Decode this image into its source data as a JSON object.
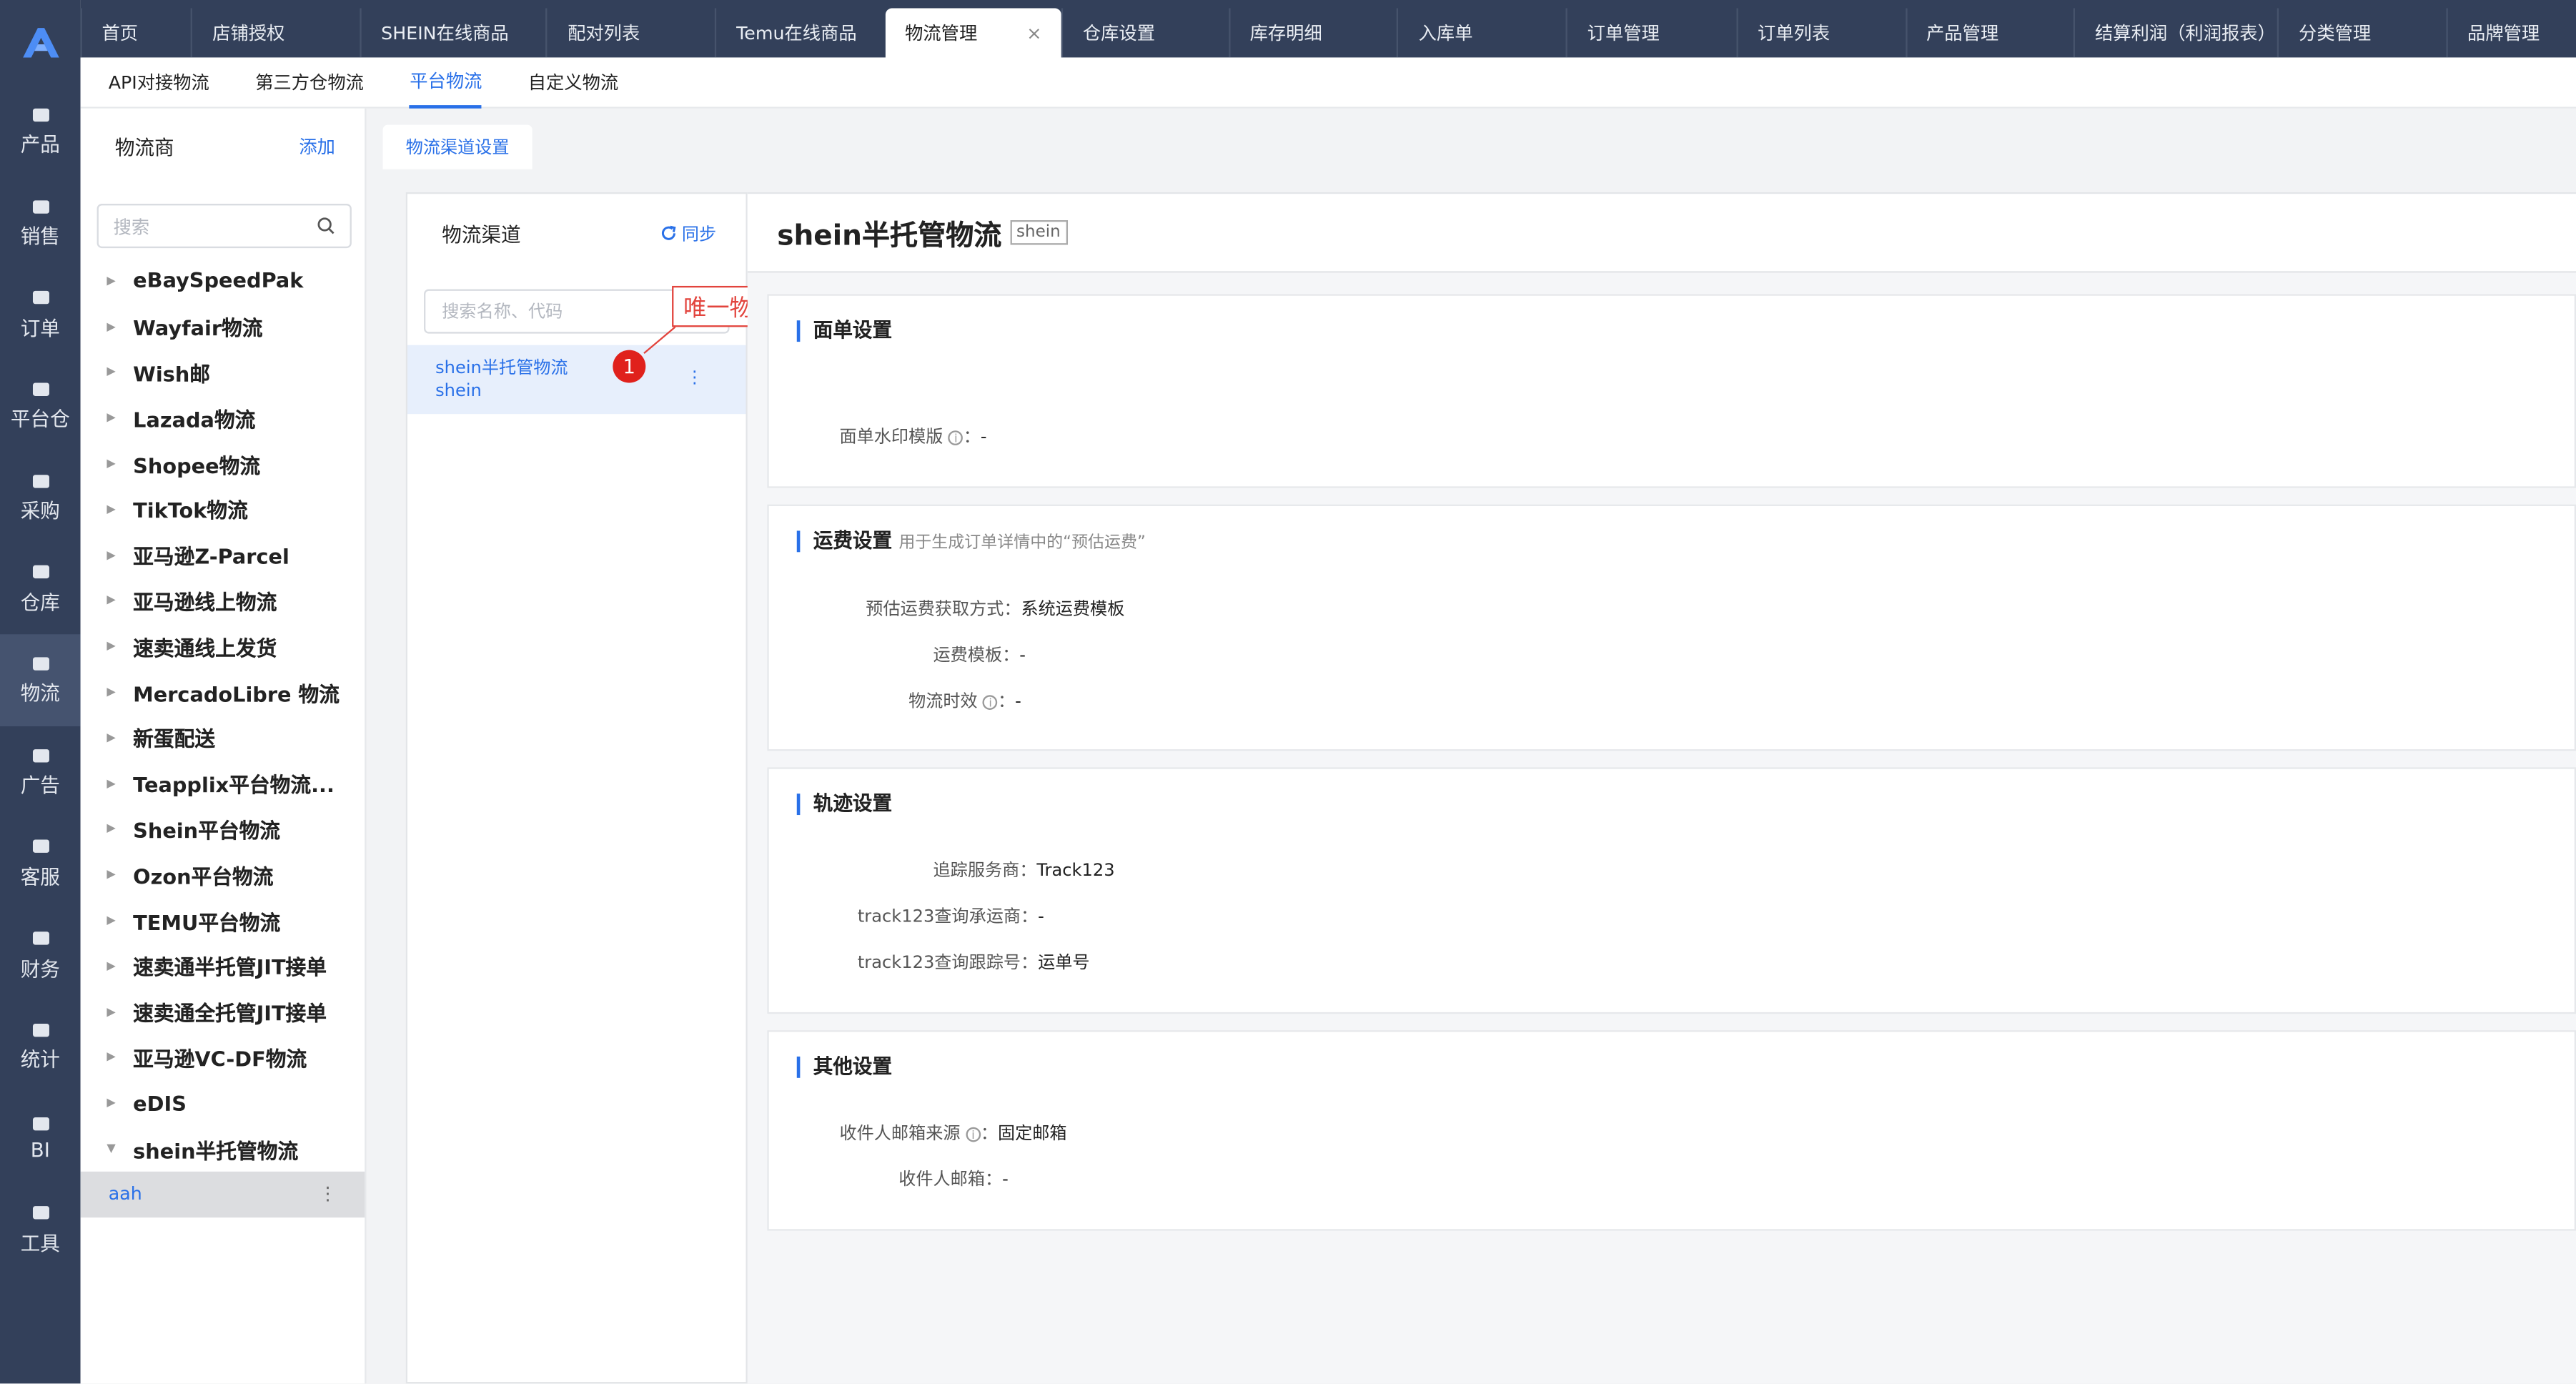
{
  "nav": {
    "items": [
      {
        "label": "产品",
        "icon": "box-icon"
      },
      {
        "label": "销售",
        "icon": "sell-icon"
      },
      {
        "label": "订单",
        "icon": "order-icon"
      },
      {
        "label": "平台仓",
        "icon": "warehouse-icon"
      },
      {
        "label": "采购",
        "icon": "cart-icon"
      },
      {
        "label": "仓库",
        "icon": "store-icon"
      },
      {
        "label": "物流",
        "icon": "truck-icon"
      },
      {
        "label": "广告",
        "icon": "ad-icon"
      },
      {
        "label": "客服",
        "icon": "mail-icon"
      },
      {
        "label": "财务",
        "icon": "yen-icon"
      },
      {
        "label": "统计",
        "icon": "pie-icon"
      },
      {
        "label": "BI",
        "icon": "bi-icon"
      },
      {
        "label": "工具",
        "icon": "wrench-icon"
      }
    ]
  },
  "tabs": [
    {
      "label": "首页"
    },
    {
      "label": "店铺授权"
    },
    {
      "label": "SHEIN在线商品"
    },
    {
      "label": "配对列表"
    },
    {
      "label": "Temu在线商品"
    },
    {
      "label": "物流管理",
      "close": "×"
    },
    {
      "label": "仓库设置"
    },
    {
      "label": "库存明细"
    },
    {
      "label": "入库单"
    },
    {
      "label": "订单管理"
    },
    {
      "label": "订单列表"
    },
    {
      "label": "产品管理"
    },
    {
      "label": "结算利润（利润报表）"
    },
    {
      "label": "分类管理"
    },
    {
      "label": "品牌管理"
    }
  ],
  "subtabs": [
    {
      "label": "API对接物流"
    },
    {
      "label": "第三方仓物流"
    },
    {
      "label": "平台物流"
    },
    {
      "label": "自定义物流"
    }
  ],
  "left": {
    "title": "物流商",
    "add": "添加",
    "search_placeholder": "搜索",
    "providers": [
      "eBaySpeedPak",
      "Wayfair物流",
      "Wish邮",
      "Lazada物流",
      "Shopee物流",
      "TikTok物流",
      "亚马逊Z-Parcel",
      "亚马逊线上物流",
      "速卖通线上发货",
      "MercadoLibre 物流",
      "新蛋配送",
      "Teapplix平台物流...",
      "Shein平台物流",
      "Ozon平台物流",
      "TEMU平台物流",
      "速卖通半托管JIT接单",
      "速卖通全托管JIT接单",
      "亚马逊VC-DF物流",
      "eDIS",
      "shein半托管物流"
    ],
    "sub_item": "aah",
    "sub_more": "⋮"
  },
  "main": {
    "tab": "物流渠道设置",
    "channels": {
      "title": "物流渠道",
      "sync": "同步",
      "search_placeholder": "搜索名称、代码",
      "item_name": "shein半托管物流",
      "item_code": "shein",
      "more": "⋮"
    },
    "annotation": {
      "text": "唯一物流渠道",
      "num": "1"
    },
    "detail": {
      "title": "shein半托管物流",
      "tag": "shein",
      "label_section": {
        "title": "面单设置",
        "watermark_label": "面单水印模版",
        "watermark_value": "-"
      },
      "fee_section": {
        "title": "运费设置",
        "hint": "用于生成订单详情中的“预估运费”",
        "method_label": "预估运费获取方式：",
        "method_value": "系统运费模板",
        "template_label": "运费模板：",
        "template_value": "-",
        "aging_label": "物流时效",
        "aging_value": "-"
      },
      "track_section": {
        "title": "轨迹设置",
        "provider_label": "追踪服务商：",
        "provider_value": "Track123",
        "carrier_label": "track123查询承运商：",
        "carrier_value": "-",
        "number_label": "track123查询跟踪号：",
        "number_value": "运单号"
      },
      "other_section": {
        "title": "其他设置",
        "email_source_label": "收件人邮箱来源",
        "email_source_value": "固定邮箱",
        "email_label": "收件人邮箱：",
        "email_value": "-"
      }
    }
  },
  "colors": {
    "sidebar": "#33405a",
    "accent": "#2970e8",
    "annotation": "#e2443d"
  }
}
